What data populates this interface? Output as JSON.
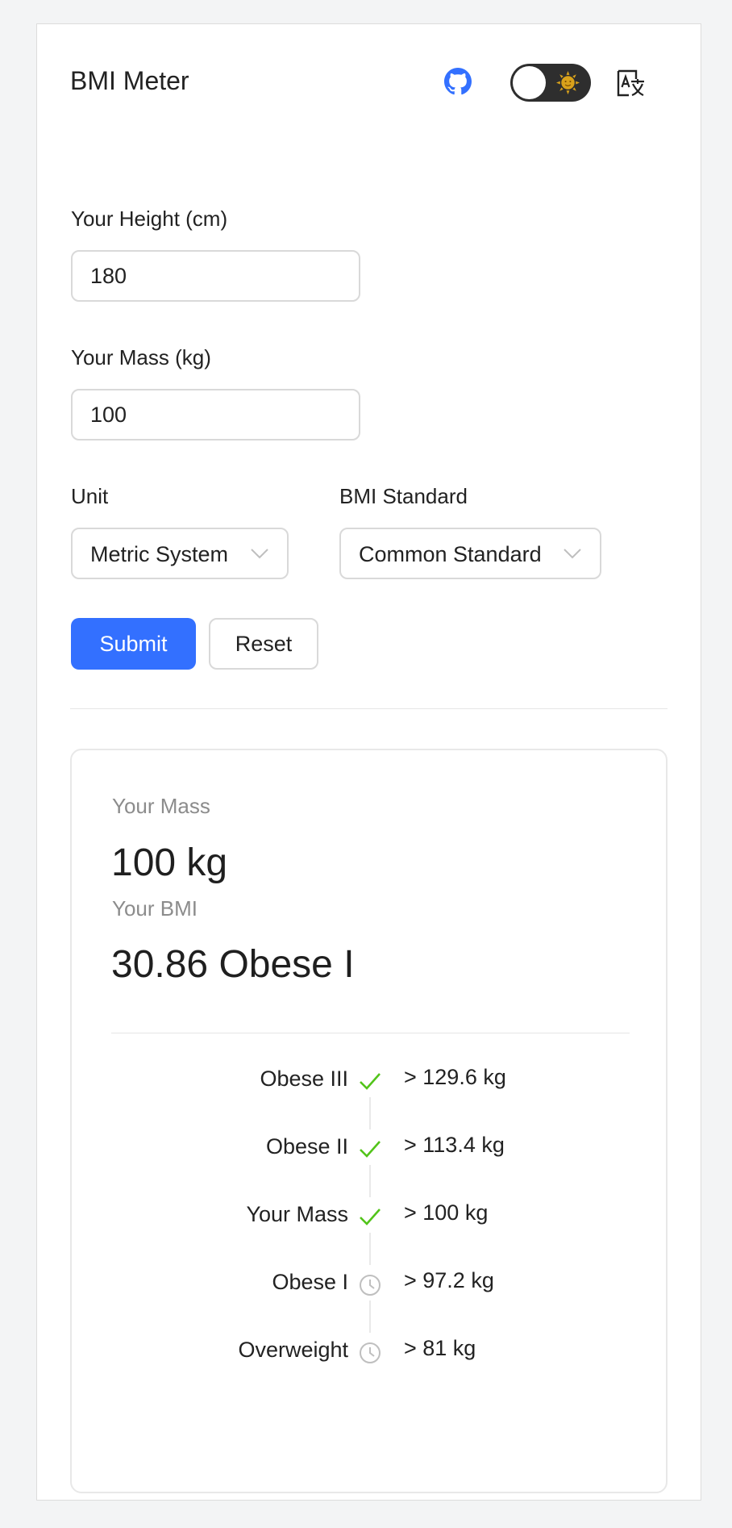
{
  "header": {
    "title": "BMI Meter",
    "github_icon": "github-icon",
    "theme_toggle_icon": "sun-icon",
    "translate_icon": "translate-icon"
  },
  "form": {
    "height_label": "Your Height (cm)",
    "height_value": "180",
    "mass_label": "Your Mass (kg)",
    "mass_value": "100",
    "unit_label": "Unit",
    "unit_value": "Metric System",
    "standard_label": "BMI Standard",
    "standard_value": "Common Standard",
    "submit_label": "Submit",
    "reset_label": "Reset"
  },
  "result": {
    "mass_title": "Your Mass",
    "mass_value": "100 kg",
    "bmi_title": "Your BMI",
    "bmi_value": "30.86 Obese I",
    "timeline": [
      {
        "label": "Obese III",
        "value": "> 129.6 kg",
        "status": "done"
      },
      {
        "label": "Obese II",
        "value": "> 113.4 kg",
        "status": "done"
      },
      {
        "label": "Your Mass",
        "value": "> 100 kg",
        "status": "done"
      },
      {
        "label": "Obese I",
        "value": "> 97.2 kg",
        "status": "pending"
      },
      {
        "label": "Overweight",
        "value": "> 81 kg",
        "status": "pending"
      }
    ]
  },
  "colors": {
    "primary": "#3370ff",
    "check": "#52c41a",
    "pending": "#bfbfbf"
  }
}
